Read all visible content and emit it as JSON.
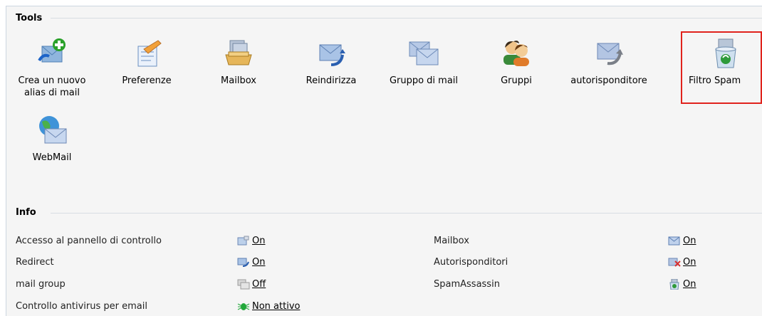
{
  "tools": {
    "heading": "Tools",
    "items": [
      {
        "label1": "Crea un nuovo",
        "label2": "alias di mail",
        "icon": "add-alias-icon"
      },
      {
        "label1": "Preferenze",
        "label2": "",
        "icon": "preferences-icon"
      },
      {
        "label1": "Mailbox",
        "label2": "",
        "icon": "mailbox-icon"
      },
      {
        "label1": "Reindirizza",
        "label2": "",
        "icon": "redirect-icon"
      },
      {
        "label1": "Gruppo di mail",
        "label2": "",
        "icon": "mail-group-icon"
      },
      {
        "label1": "Gruppi",
        "label2": "",
        "icon": "groups-icon"
      },
      {
        "label1": "autorisponditore",
        "label2": "",
        "icon": "autoresponder-icon"
      },
      {
        "label1": "Filtro Spam",
        "label2": "",
        "icon": "spam-filter-icon"
      },
      {
        "label1": "WebMail",
        "label2": "",
        "icon": "webmail-icon"
      }
    ]
  },
  "info": {
    "heading": "Info",
    "left": [
      {
        "label": "Accesso al pannello di controllo",
        "status": "On"
      },
      {
        "label": "Redirect",
        "status": "On"
      },
      {
        "label": "mail group",
        "status": "Off"
      },
      {
        "label": "Controllo antivirus per email",
        "status": "Non attivo"
      }
    ],
    "right": [
      {
        "label": "Mailbox",
        "status": "On"
      },
      {
        "label": "Autorisponditori",
        "status": "On"
      },
      {
        "label": "SpamAssassin",
        "status": "On"
      }
    ]
  },
  "colors": {
    "highlight_border": "#e0221c",
    "panel_bg": "#f5f5f5"
  }
}
